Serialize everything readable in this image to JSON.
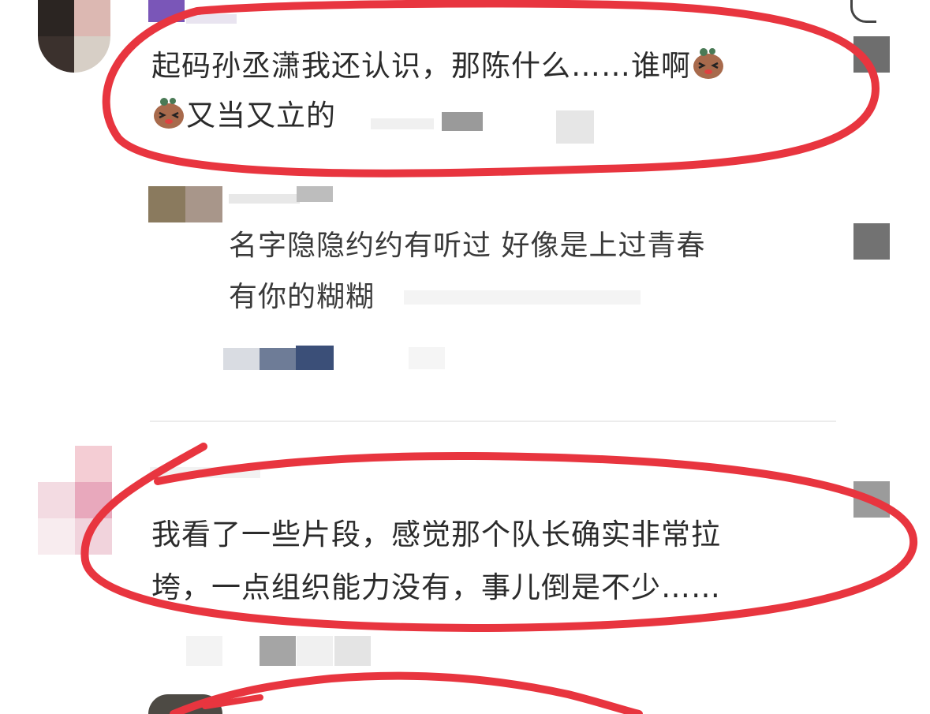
{
  "comments": [
    {
      "text_line1": "起码孙丞潇我还认识，那陈什么……谁啊",
      "text_line2": "又当又立的",
      "emoji_name": "pig-face-icon"
    },
    {
      "text_line1": "名字隐隐约约有听过 好像是上过青春",
      "text_line2": "有你的糊糊"
    },
    {
      "text_line1": "我看了一些片段，感觉那个队长确实非常拉",
      "text_line2": "垮，一点组织能力没有，事儿倒是不少……"
    }
  ],
  "colors": {
    "annotation": "#e8353f",
    "text": "#2b2b2b"
  }
}
